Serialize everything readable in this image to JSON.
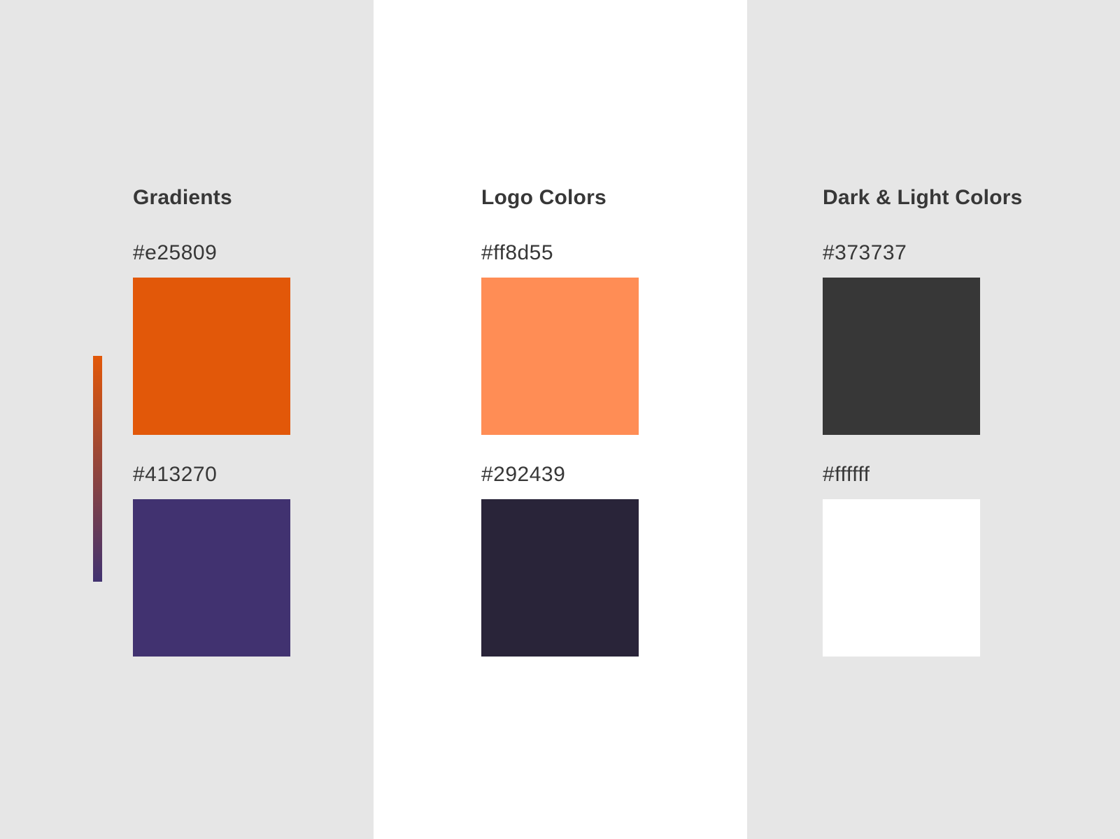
{
  "columns": [
    {
      "heading": "Gradients",
      "colors": [
        {
          "hex": "#e25809"
        },
        {
          "hex": "#413270"
        }
      ],
      "gradient": {
        "from": "#e25809",
        "to": "#413270"
      }
    },
    {
      "heading": "Logo Colors",
      "colors": [
        {
          "hex": "#ff8d55"
        },
        {
          "hex": "#292439"
        }
      ]
    },
    {
      "heading": "Dark & Light Colors",
      "colors": [
        {
          "hex": "#373737"
        },
        {
          "hex": "#ffffff"
        }
      ]
    }
  ]
}
